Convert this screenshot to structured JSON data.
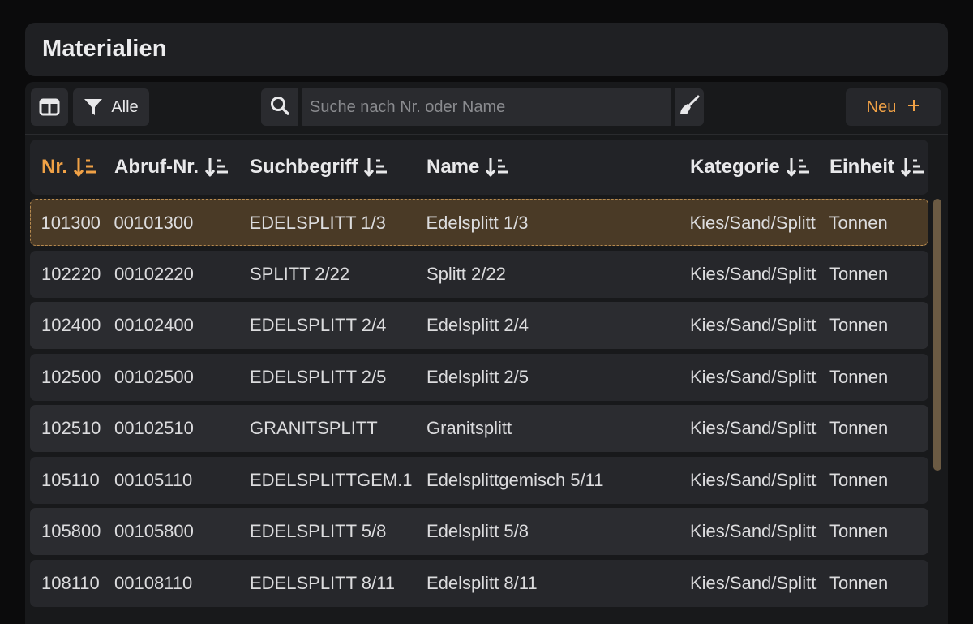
{
  "page": {
    "title": "Materialien"
  },
  "toolbar": {
    "columns_toggle_icon": "columns-icon",
    "filter_label": "Alle",
    "filter_icon": "filter-icon",
    "search_icon": "search-icon",
    "search_placeholder": "Suche nach Nr. oder Name",
    "search_value": "",
    "clear_icon": "broom-icon",
    "new_label": "Neu",
    "new_icon": "plus-icon"
  },
  "colors": {
    "accent": "#f0a146",
    "selected_row": "#4a3a26",
    "background": "#0b0b0c",
    "card": "#1f2023"
  },
  "table": {
    "columns": [
      {
        "key": "nr",
        "label": "Nr.",
        "active": true
      },
      {
        "key": "abruf",
        "label": "Abruf-Nr.",
        "active": false
      },
      {
        "key": "such",
        "label": "Suchbegriff",
        "active": false
      },
      {
        "key": "name",
        "label": "Name",
        "active": false
      },
      {
        "key": "kat",
        "label": "Kategorie",
        "active": false
      },
      {
        "key": "einheit",
        "label": "Einheit",
        "active": false
      }
    ],
    "sort_icon": "sort-ascending-icon",
    "rows": [
      {
        "nr": "101300",
        "abruf": "00101300",
        "such": "EDELSPLITT 1/3",
        "name": "Edelsplitt 1/3",
        "kat": "Kies/Sand/Splitt",
        "einheit": "Tonnen",
        "selected": true
      },
      {
        "nr": "102220",
        "abruf": "00102220",
        "such": "SPLITT 2/22",
        "name": "Splitt 2/22",
        "kat": "Kies/Sand/Splitt",
        "einheit": "Tonnen"
      },
      {
        "nr": "102400",
        "abruf": "00102400",
        "such": "EDELSPLITT 2/4",
        "name": "Edelsplitt 2/4",
        "kat": "Kies/Sand/Splitt",
        "einheit": "Tonnen"
      },
      {
        "nr": "102500",
        "abruf": "00102500",
        "such": "EDELSPLITT 2/5",
        "name": "Edelsplitt 2/5",
        "kat": "Kies/Sand/Splitt",
        "einheit": "Tonnen"
      },
      {
        "nr": "102510",
        "abruf": "00102510",
        "such": "GRANITSPLITT",
        "name": "Granitsplitt",
        "kat": "Kies/Sand/Splitt",
        "einheit": "Tonnen"
      },
      {
        "nr": "105110",
        "abruf": "00105110",
        "such": "EDELSPLITTGEM.1",
        "name": "Edelsplittgemisch 5/11",
        "kat": "Kies/Sand/Splitt",
        "einheit": "Tonnen"
      },
      {
        "nr": "105800",
        "abruf": "00105800",
        "such": "EDELSPLITT 5/8",
        "name": "Edelsplitt 5/8",
        "kat": "Kies/Sand/Splitt",
        "einheit": "Tonnen"
      },
      {
        "nr": "108110",
        "abruf": "00108110",
        "such": "EDELSPLITT 8/11",
        "name": "Edelsplitt 8/11",
        "kat": "Kies/Sand/Splitt",
        "einheit": "Tonnen"
      }
    ]
  }
}
